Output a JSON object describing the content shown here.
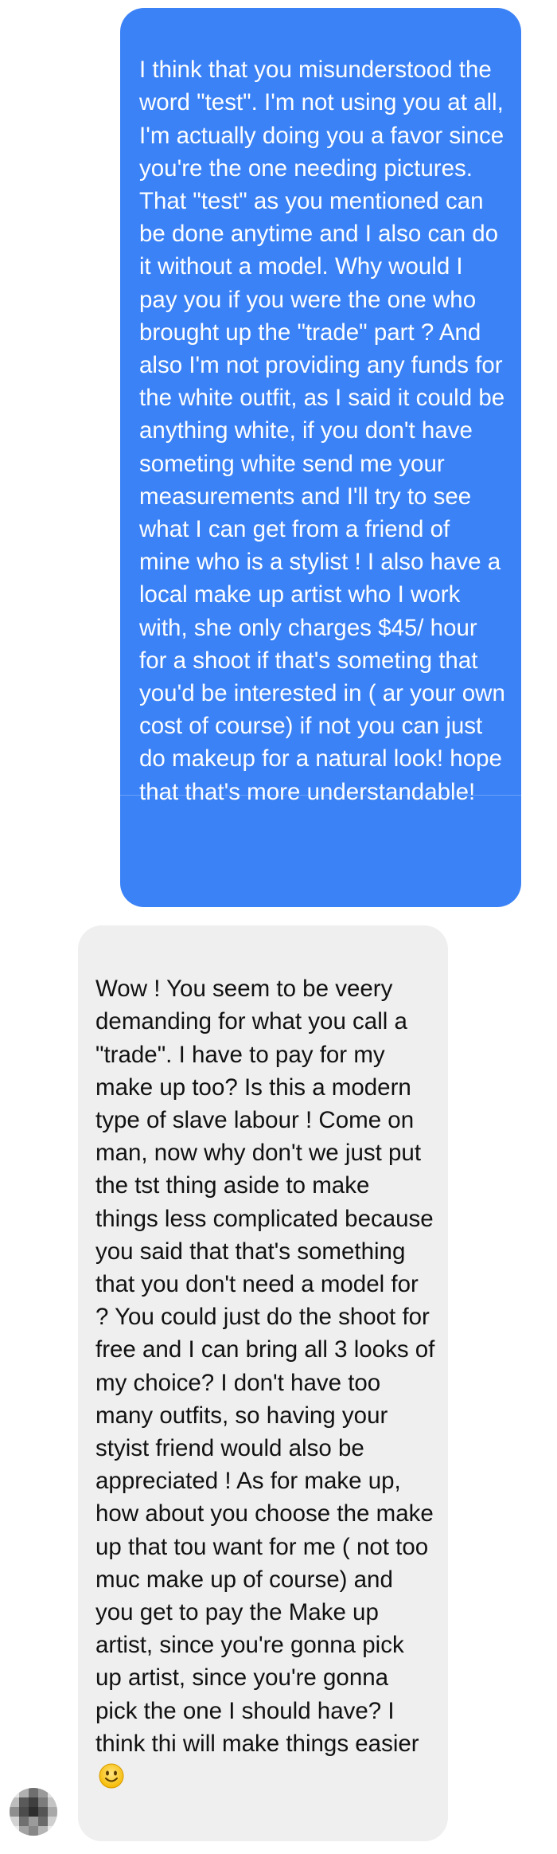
{
  "conversation": {
    "outgoing_message": {
      "text": "I think that you misunderstood the word \"test\". I'm not using you at all, I'm actually doing you a favor since you're the one needing pictures. That \"test\" as you mentioned can be done anytime and I also can do it without a model. Why would I pay you if you were the one who brought up the \"trade\" part ? And also I'm not providing any funds for the white outfit, as I said it could be anything white, if you don't have someting white send me your measurements and I'll try to see what I can get from a friend of mine who is a stylist ! I also have a local make up artist who I work with, she only charges $45/ hour for a shoot if that's someting that you'd be interested in ( ar your own cost of course) if not you can just do makeup for a natural look! hope that that's more understandable!",
      "color": "#3b82f6"
    },
    "incoming_message": {
      "text": "Wow ! You seem to be veery demanding for what you call a \"trade\". I have to pay for my make up too? Is this a modern type of slave labour ! Come on man, now why don't we just put the tst thing aside to make things less complicated because you said that that's something that you don't need a model for ? You could just do the shoot for free and I can bring all 3 looks of my choice? I don't have too many outfits, so having your styist friend would also be appreciated ! As for make up, how about you choose the make up that tou want for me ( not too muc make up of course) and you get to pay the Make up artist, since you're gonna pick up artist, since you're gonna pick the one I should have? I think thi will make things easier",
      "emoji": "slightly-smiling-face-icon",
      "color": "#efefef"
    },
    "sender_avatar": {
      "style": "pixelated"
    }
  }
}
